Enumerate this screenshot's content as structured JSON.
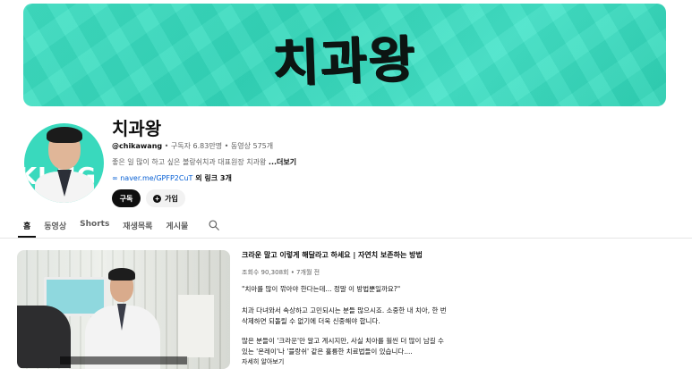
{
  "banner": {
    "title": "치과왕"
  },
  "avatar": {
    "text": "KI NG"
  },
  "channel": {
    "name": "치과왕",
    "handle": "@chikawang",
    "meta_rest": " • 구독자 6.83만명 • 동영상 575개",
    "description": "좋은 일 많이 하고 싶은 볼랑쉬치과 대표원장 치과왕 ",
    "description_more": "...더보기",
    "link": "naver.me/GPFP2CuT",
    "link_extra": " 외 링크 3개"
  },
  "buttons": {
    "subscribe": "구독",
    "join": "가입"
  },
  "tabs": [
    {
      "label": "홈",
      "active": true
    },
    {
      "label": "동영상"
    },
    {
      "label": "Shorts"
    },
    {
      "label": "재생목록"
    },
    {
      "label": "게시물"
    }
  ],
  "icons": {
    "search": "search-icon",
    "link": "link-icon",
    "join": "plus-icon"
  },
  "featured_video": {
    "title": "크라운 말고 이렇게 해달라고 하세요 | 자연치 보존하는 방법",
    "meta": "조회수 90,308회 • 7개월 전",
    "desc_1": "\"치아를 많이 깎아야 한다는데... 정말 이 방법뿐일까요?\"",
    "desc_2": "치과 다녀와서 속상하고 고민되시는 분들 많으시죠. 소중한 내 치아, 한 번 삭제하면 되돌릴 수 없기에 더욱 신중해야 합니다.",
    "desc_3": "많은 분들이 '크라운'만 알고 계시지만, 사실 치아를 훨씬 더 많이 남길 수 있는 '온레이'나 '블랑쉬' 같은 훌륭한 치료법들이 있습니다....",
    "read_more": "자세히 알아보기"
  },
  "colors": {
    "banner": "#3fe0c4",
    "text": "#0f0f0f",
    "secondary": "#606060",
    "link": "#065fd4"
  }
}
